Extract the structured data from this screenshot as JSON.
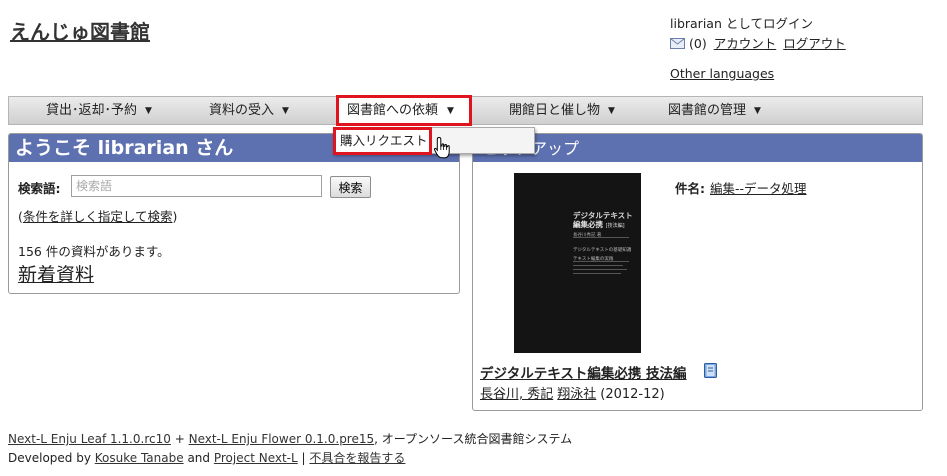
{
  "header": {
    "site_title": "えんじゅ図書館",
    "login_status": "librarian としてログイン",
    "message_count": "(0)",
    "account_link": "アカウント",
    "logout_link": "ログアウト",
    "other_languages": "Other languages"
  },
  "nav": {
    "items": [
      {
        "label": "貸出･返却･予約"
      },
      {
        "label": "資料の受入"
      },
      {
        "label": "図書館への依頼"
      },
      {
        "label": "開館日と催し物"
      },
      {
        "label": "図書館の管理"
      }
    ],
    "active_index": 2,
    "caret": "▼",
    "dropdown": {
      "items": [
        {
          "label": "購入リクエスト"
        }
      ]
    }
  },
  "welcome_panel": {
    "title": "ようこそ librarian さん",
    "search_label": "検索語:",
    "search_placeholder": "検索語",
    "search_button": "検索",
    "advanced_prefix": "(",
    "advanced_link": "条件を詳しく指定して検索",
    "advanced_suffix": ")",
    "count_text": "156 件の資料があります。",
    "new_materials_link": "新着資料"
  },
  "pickup_panel": {
    "title": "ピックアップ",
    "subject_label": "件名:",
    "subject_value": "編集--データ処理",
    "cover": {
      "title_line1": "デジタルテキスト",
      "title_line2": "編集必携",
      "edition": "[技法編]",
      "author_small": "長谷川秀記 著",
      "subtitle_line1": "デジタルテキストの基礎知識",
      "subtitle_line2": "テキスト編集の実践"
    },
    "book_title": "デジタルテキスト編集必携 技法編",
    "author": "長谷川, 秀記",
    "publisher": "翔泳社",
    "year": "(2012-12)",
    "book_icon": "book-icon"
  },
  "footer": {
    "leaf_link": "Next-L Enju Leaf 1.1.0.rc10",
    "plus": "+",
    "flower_link": "Next-L Enju Flower 0.1.0.pre15",
    "system_text": ", オープンソース統合図書館システム",
    "developed_by": "Developed by",
    "developer_link": "Kosuke Tanabe",
    "and_text": "and",
    "project_link": "Project Next-L",
    "separator": "|",
    "bug_report_link": "不具合を報告する"
  },
  "colors": {
    "panel_header": "#5d70b0",
    "highlight_border": "#e0141e",
    "nav_bar": "#dcdcdc"
  }
}
